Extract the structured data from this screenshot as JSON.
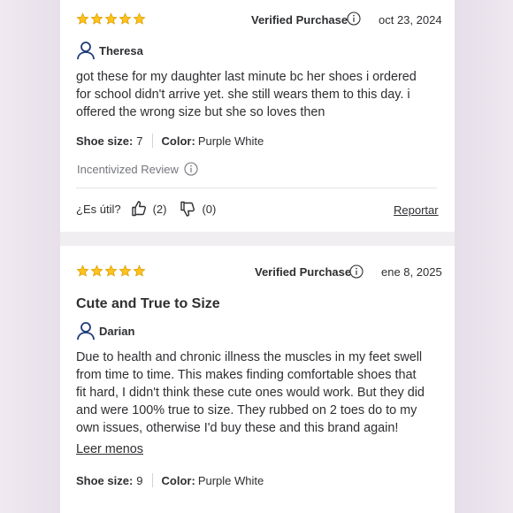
{
  "reviews": [
    {
      "rating": 5,
      "badge": "Verified Purchase",
      "date": "oct 23, 2024",
      "user": "Theresa",
      "text_lines": [
        "got these for my daughter last minute bc her shoes i ordered",
        "for school didn't arrive yet. she still wears them to this day. i",
        "offered the wrong size but she so loves then"
      ],
      "shoe_size_label": "Shoe size:",
      "shoe_size_value": "7",
      "color_label": "Color:",
      "color_value": "Purple White",
      "incentivized": "Incentivized Review",
      "helpful_label": "¿Es útil?",
      "up_count": "(2)",
      "down_count": "(0)",
      "report": "Reportar"
    },
    {
      "rating": 5,
      "badge": "Verified Purchase",
      "date": "ene 8, 2025",
      "title": "Cute and True to Size",
      "user": "Darian",
      "text_lines": [
        "Due to health and chronic illness the muscles in my feet swell",
        "from time to time. This makes finding comfortable shoes that",
        "fit hard, I didn't think these cute ones would work. But they did",
        "and were 100% true to size. They rubbed on 2 toes do to my",
        "own issues, otherwise I'd buy these and this brand again!"
      ],
      "read_less": "Leer menos",
      "shoe_size_label": "Shoe size:",
      "shoe_size_value": "9",
      "color_label": "Color:",
      "color_value": "Purple White"
    }
  ],
  "colors": {
    "star": "#ffc220",
    "star_stroke": "#d89e00",
    "text": "#2e2f32",
    "muted": "#74767c",
    "user_icon": "#1f3d7a"
  },
  "icons": {
    "star": "star-icon",
    "info": "info-icon",
    "user": "user-icon",
    "thumbs_up": "thumbs-up-icon",
    "thumbs_down": "thumbs-down-icon"
  }
}
